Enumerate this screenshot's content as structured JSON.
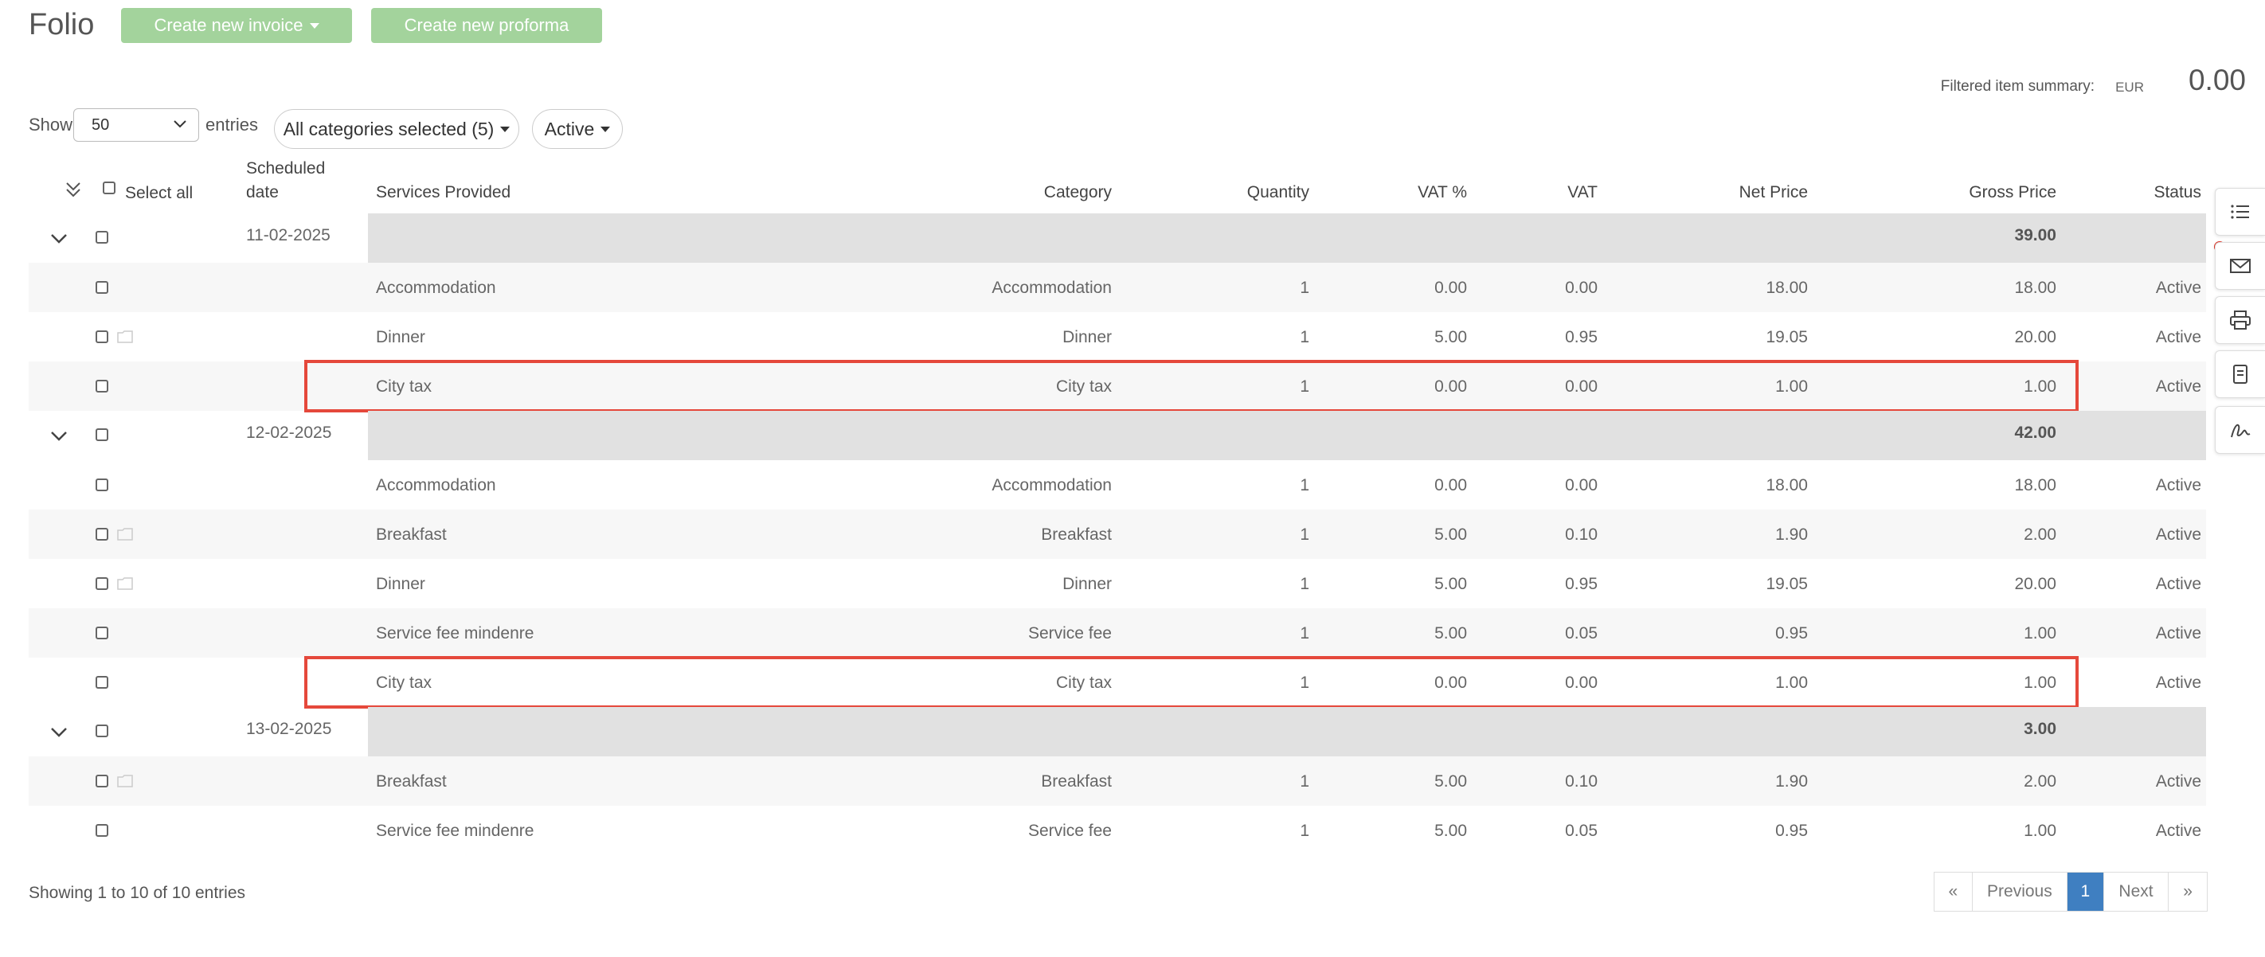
{
  "header": {
    "title": "Folio",
    "create_invoice_label": "Create new invoice",
    "create_proforma_label": "Create new proforma"
  },
  "summary": {
    "label": "Filtered item summary:",
    "currency": "EUR",
    "value": "0.00"
  },
  "filters": {
    "show_label": "Show",
    "entries_value": "50",
    "entries_label": "entries",
    "categories_label": "All categories selected (5)",
    "status_label": "Active"
  },
  "table": {
    "headers": {
      "select_all": "Select all",
      "scheduled_date_1": "Scheduled",
      "scheduled_date_2": "date",
      "services": "Services Provided",
      "category": "Category",
      "quantity": "Quantity",
      "vat_pct": "VAT %",
      "vat": "VAT",
      "net": "Net Price",
      "gross": "Gross Price",
      "status": "Status"
    },
    "groups": [
      {
        "date": "11-02-2025",
        "total": "39.00",
        "items": [
          {
            "service": "Accommodation",
            "category": "Accommodation",
            "qty": "1",
            "vat_pct": "0.00",
            "vat": "0.00",
            "net": "18.00",
            "gross": "18.00",
            "status": "Active",
            "icon": false,
            "highlighted": false
          },
          {
            "service": "Dinner",
            "category": "Dinner",
            "qty": "1",
            "vat_pct": "5.00",
            "vat": "0.95",
            "net": "19.05",
            "gross": "20.00",
            "status": "Active",
            "icon": true,
            "highlighted": false
          },
          {
            "service": "City tax",
            "category": "City tax",
            "qty": "1",
            "vat_pct": "0.00",
            "vat": "0.00",
            "net": "1.00",
            "gross": "1.00",
            "status": "Active",
            "icon": false,
            "highlighted": true
          }
        ]
      },
      {
        "date": "12-02-2025",
        "total": "42.00",
        "items": [
          {
            "service": "Accommodation",
            "category": "Accommodation",
            "qty": "1",
            "vat_pct": "0.00",
            "vat": "0.00",
            "net": "18.00",
            "gross": "18.00",
            "status": "Active",
            "icon": false,
            "highlighted": false
          },
          {
            "service": "Breakfast",
            "category": "Breakfast",
            "qty": "1",
            "vat_pct": "5.00",
            "vat": "0.10",
            "net": "1.90",
            "gross": "2.00",
            "status": "Active",
            "icon": true,
            "highlighted": false
          },
          {
            "service": "Dinner",
            "category": "Dinner",
            "qty": "1",
            "vat_pct": "5.00",
            "vat": "0.95",
            "net": "19.05",
            "gross": "20.00",
            "status": "Active",
            "icon": true,
            "highlighted": false
          },
          {
            "service": "Service fee mindenre",
            "category": "Service fee",
            "qty": "1",
            "vat_pct": "5.00",
            "vat": "0.05",
            "net": "0.95",
            "gross": "1.00",
            "status": "Active",
            "icon": false,
            "highlighted": false
          },
          {
            "service": "City tax",
            "category": "City tax",
            "qty": "1",
            "vat_pct": "0.00",
            "vat": "0.00",
            "net": "1.00",
            "gross": "1.00",
            "status": "Active",
            "icon": false,
            "highlighted": true
          }
        ]
      },
      {
        "date": "13-02-2025",
        "total": "3.00",
        "items": [
          {
            "service": "Breakfast",
            "category": "Breakfast",
            "qty": "1",
            "vat_pct": "5.00",
            "vat": "0.10",
            "net": "1.90",
            "gross": "2.00",
            "status": "Active",
            "icon": true,
            "highlighted": false
          },
          {
            "service": "Service fee mindenre",
            "category": "Service fee",
            "qty": "1",
            "vat_pct": "5.00",
            "vat": "0.05",
            "net": "0.95",
            "gross": "1.00",
            "status": "Active",
            "icon": false,
            "highlighted": false
          }
        ]
      }
    ]
  },
  "footer": {
    "showing": "Showing 1 to 10 of 10 entries",
    "pager": {
      "first": "«",
      "previous": "Previous",
      "current": "1",
      "next": "Next",
      "last": "»"
    }
  },
  "side_actions": [
    "list-icon",
    "mail-icon",
    "printer-icon",
    "document-icon",
    "signature-icon"
  ],
  "colors": {
    "green_button": "#a3d39c",
    "highlight": "#e5483b",
    "pager_active": "#3f7fc1",
    "notification_dot": "#e0382b"
  }
}
